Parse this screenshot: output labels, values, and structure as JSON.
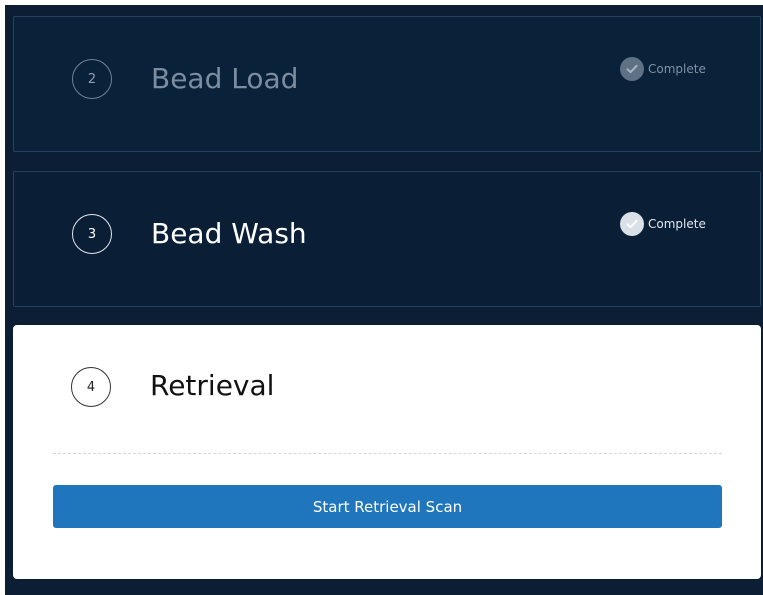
{
  "steps": [
    {
      "number": "2",
      "title": "Bead Load",
      "status": "Complete"
    },
    {
      "number": "3",
      "title": "Bead Wash",
      "status": "Complete"
    },
    {
      "number": "4",
      "title": "Retrieval",
      "action_label": "Start Retrieval Scan"
    }
  ],
  "colors": {
    "background": "#0c1e33",
    "card_dim": "#0a213a",
    "card_active": "#0a1f36",
    "active_card": "#ffffff",
    "button": "#1f76bc"
  },
  "icons": {
    "status": "check-icon"
  }
}
